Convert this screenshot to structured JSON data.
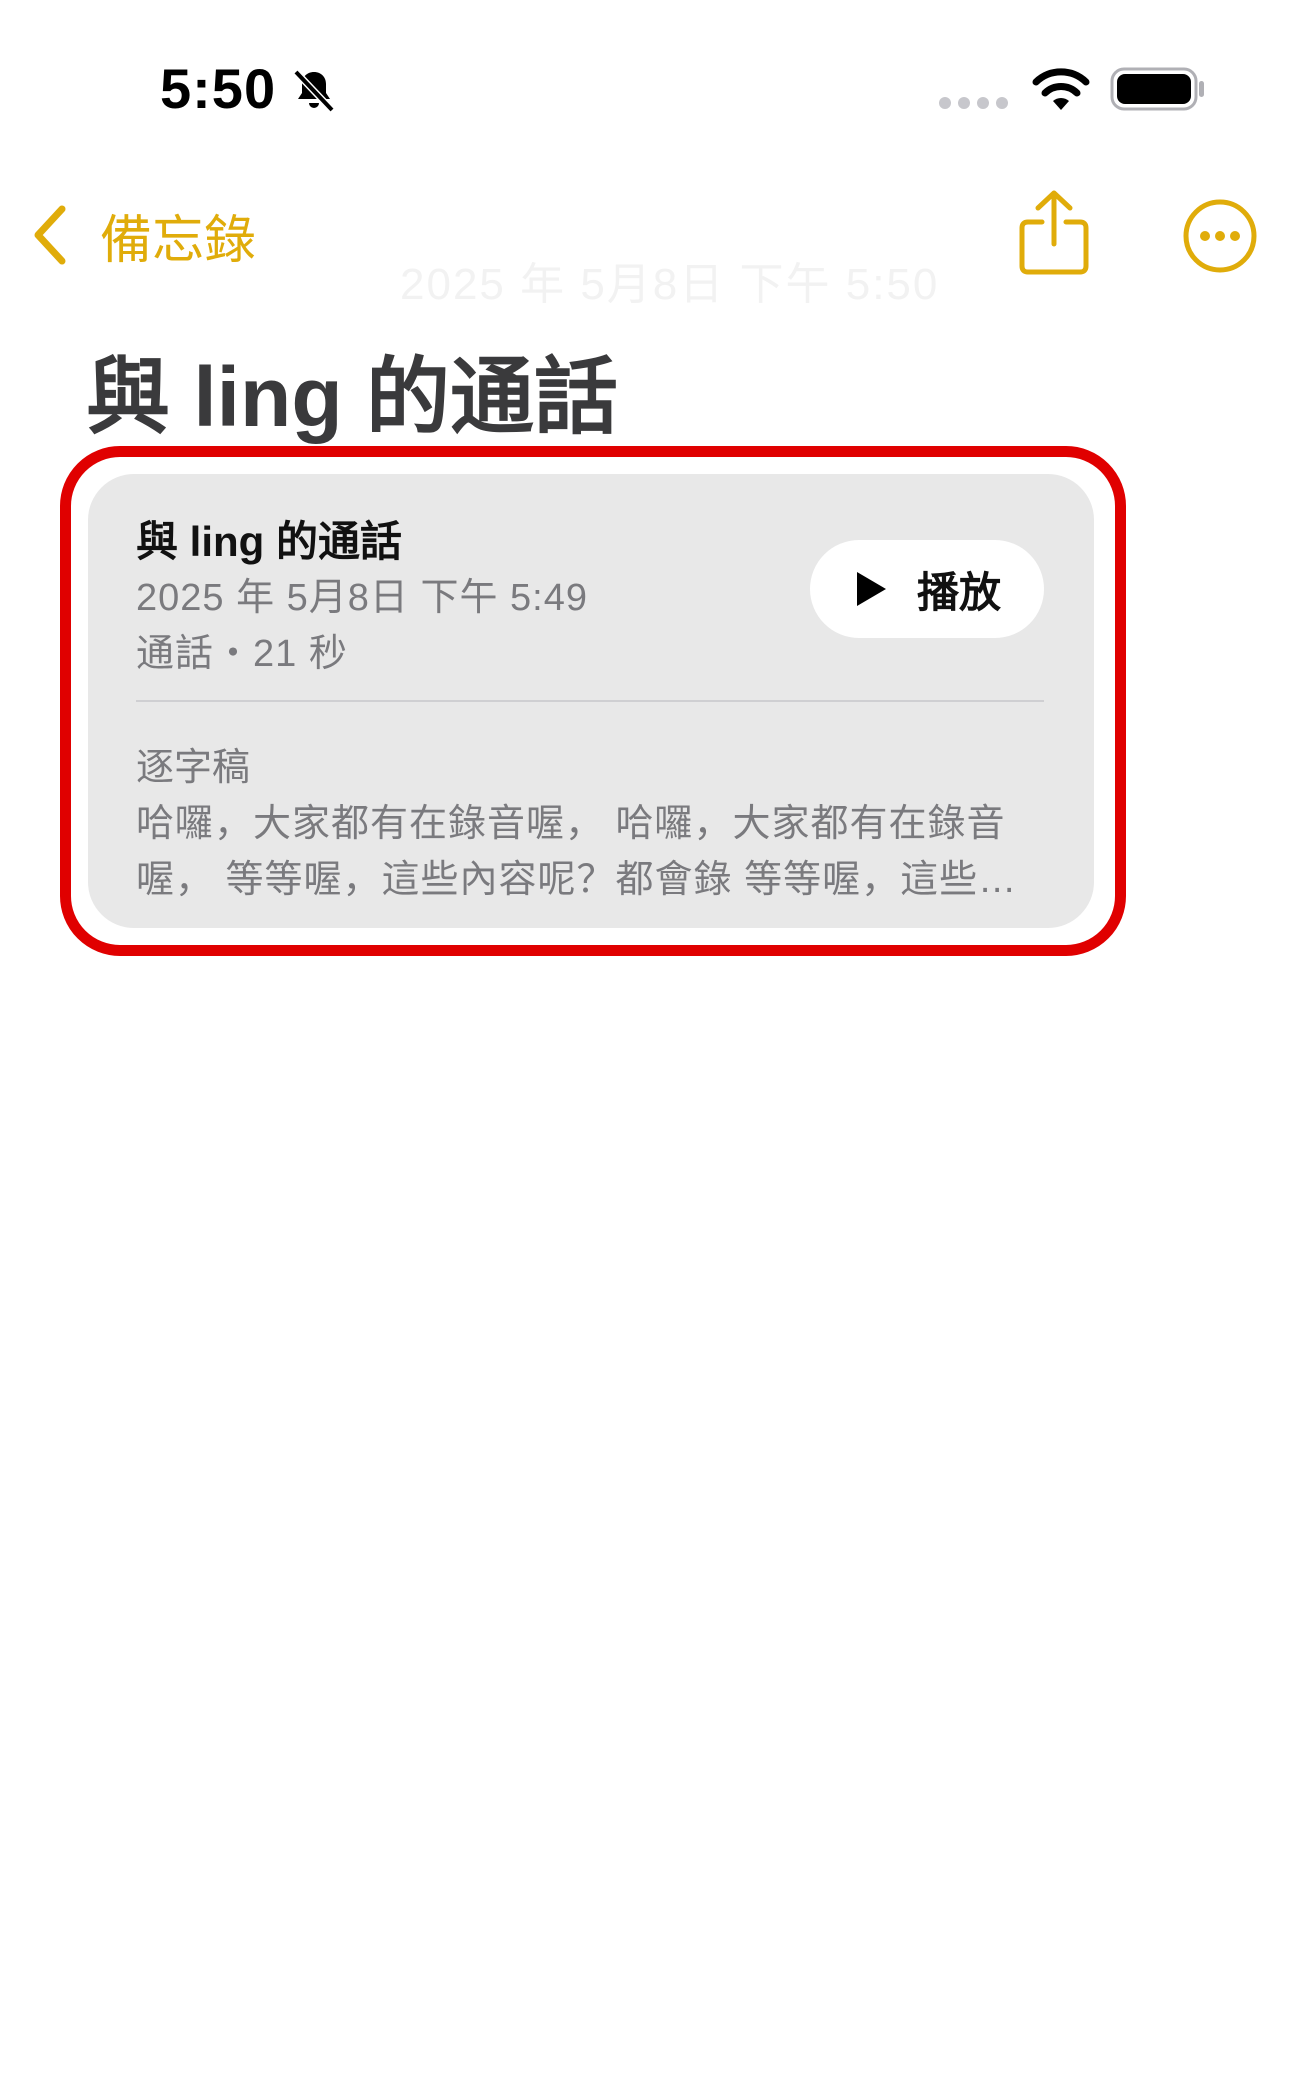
{
  "status_bar": {
    "time": "5:50"
  },
  "nav": {
    "back_label": "備忘錄",
    "faded_date": "2025 年 5月8日 下午 5:50"
  },
  "note": {
    "title": "與 ling 的通話"
  },
  "card": {
    "title": "與 ling 的通話",
    "date": "2025 年 5月8日 下午 5:49",
    "meta": "通話・21 秒",
    "play_label": "播放",
    "transcript_label": "逐字稿",
    "transcript_text": "哈囉，大家都有在錄音喔， 哈囉，大家都有在錄音喔， 等等喔，這些內容呢？都會錄 等等喔，這些內容呢？都會錄"
  },
  "colors": {
    "accent": "#e0ac0a",
    "highlight": "#e00000",
    "card_bg": "#e8e8e8"
  },
  "icons": [
    "bell-slash-icon",
    "signal-icon",
    "wifi-icon",
    "battery-icon",
    "chevron-left-icon",
    "share-icon",
    "more-icon",
    "play-icon"
  ]
}
